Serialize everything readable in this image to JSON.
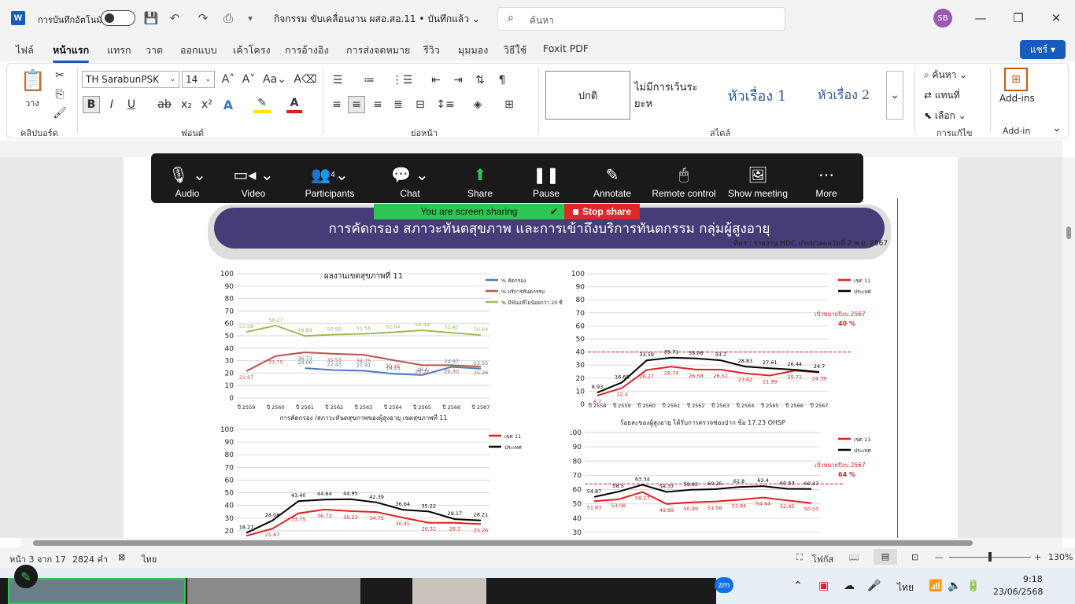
{
  "titlebar": {
    "autosave_label": "การบันทึกอัตโนมัติ",
    "doc_title": "กิจกรรม ขับเคลื่อนงาน ผสอ.สอ.11 • บันทึกแล้ว ⌄",
    "search_placeholder": "ค้นหา",
    "avatar": "SB"
  },
  "menu": {
    "tabs": [
      "ไฟล์",
      "หน้าแรก",
      "แทรก",
      "วาด",
      "ออกแบบ",
      "เค้าโครง",
      "การอ้างอิง",
      "การส่งจดหมาย",
      "รีวิว",
      "มุมมอง",
      "วิธีใช้",
      "Foxit PDF"
    ],
    "share": "แชร์"
  },
  "ribbon": {
    "paste": "วาง",
    "font_name": "TH SarabunPSK",
    "font_size": "14",
    "group_clipboard": "คลิปบอร์ด",
    "group_font": "ฟอนต์",
    "group_paragraph": "ย่อหน้า",
    "group_styles": "สไตล์",
    "group_editing": "การแก้ไข",
    "group_addin": "Add-in",
    "styles": [
      "ปกติ",
      "ไม่มีการเว้นระยะห",
      "หัวเรื่อง 1",
      "หัวเรื่อง 2"
    ],
    "find": "ค้นหา",
    "replace": "แทนที่",
    "select": "เลือก",
    "addins": "Add-ins",
    "bold": "B",
    "italic": "I",
    "underline": "U",
    "strike": "ab",
    "sub": "x₂",
    "sup": "x²"
  },
  "zoom": {
    "buttons": [
      {
        "label": "Audio"
      },
      {
        "label": "Video"
      },
      {
        "label": "Participants",
        "badge": "4"
      },
      {
        "label": "Chat"
      },
      {
        "label": "Share"
      },
      {
        "label": "Pause"
      },
      {
        "label": "Annotate"
      },
      {
        "label": "Remote control"
      },
      {
        "label": "Show meeting"
      },
      {
        "label": "More"
      }
    ],
    "sharing_text": "You are screen sharing",
    "stop_text": "Stop share"
  },
  "slide": {
    "title": "การคัดกรอง สภาวะทันตสุขภาพ และการเข้าถึงบริการทันตกรรม กลุ่มผู้สูงอายุ",
    "source": "ที่มา : รายงาน HDC ประมวลผลวันที่ 2 พ.ย. 2567",
    "vline": true
  },
  "chart_data": [
    {
      "type": "line",
      "title": "ผลงานเขตสุขภาพที่ 11",
      "categories": [
        "ปี 2559",
        "ปี 2560",
        "ปี 2561",
        "ปี 2562",
        "ปี 2563",
        "ปี 2564",
        "ปี 2565",
        "ปี 2566",
        "ปี 2567"
      ],
      "ylim": [
        0,
        100
      ],
      "legend": "top-right",
      "series": [
        {
          "name": "% คัดกรอง",
          "color": "#4a7ab7",
          "values": [
            null,
            null,
            24.0,
            22.43,
            21.91,
            19.45,
            18.4,
            24.97,
            23.55
          ]
        },
        {
          "name": "% บริการทันตกรรม",
          "color": "#c0504d",
          "values": [
            21.67,
            33.75,
            36.73,
            35.53,
            34.75,
            30.45,
            26.32,
            26.3,
            25.26
          ]
        },
        {
          "name": "% มีฟันแท้ไม่น้อยกว่า 20 ซี่",
          "color": "#9bbb59",
          "values": [
            53.08,
            58.27,
            49.89,
            50.99,
            51.56,
            52.84,
            54.44,
            52.45,
            50.64
          ]
        }
      ],
      "point_labels": [
        [
          "",
          "",
          "24.00",
          "22.43",
          "21.91",
          "19.45",
          "18.4",
          "24.97",
          "23.55"
        ],
        [
          "21.67",
          "33.75",
          "36.73",
          "35.53",
          "34.75",
          "30.45",
          "26.32",
          "26.30",
          "25.26"
        ],
        [
          "53.08",
          "58.27",
          "49.89",
          "50.99",
          "51.56",
          "52.84",
          "54.44",
          "52.45",
          "50.64"
        ]
      ]
    },
    {
      "type": "line",
      "title": "",
      "categories": [
        "ปี 2558",
        "ปี 2559",
        "ปี 2560",
        "ปี 2561",
        "ปี 2562",
        "ปี 2563",
        "ปี 2564",
        "ปี 2565",
        "ปี 2566",
        "ปี 2567"
      ],
      "ylim": [
        0,
        100
      ],
      "legend": "top-right",
      "target": {
        "label": "เป้าหมายปีงบ 2567",
        "value_label": "40 %",
        "value": 40
      },
      "series": [
        {
          "name": "เขต 11",
          "color": "#e02020",
          "values": [
            6.7,
            12.4,
            26.27,
            28.74,
            26.58,
            26.51,
            23.62,
            21.99,
            25.71,
            24.39
          ]
        },
        {
          "name": "ประเทศ",
          "color": "#000000",
          "values": [
            8.93,
            16.68,
            33.59,
            35.71,
            35.06,
            33.7,
            28.83,
            27.61,
            26.44,
            24.7
          ]
        }
      ],
      "point_labels": [
        [
          "6.7",
          "12.4",
          "26.27",
          "28.74",
          "26.58",
          "26.51",
          "23.62",
          "21.99",
          "25.71",
          "24.39"
        ],
        [
          "8.93",
          "16.68",
          "33.59",
          "35.71",
          "35.06",
          "33.7",
          "28.83",
          "27.61",
          "26.44",
          "24.7"
        ]
      ]
    },
    {
      "type": "line",
      "title": "การคัดกรอง /สภาวะทันตสุขภาพของผู้สูงอายุ เขตสุขภาพที่ 11",
      "ylim": [
        10,
        100
      ],
      "visible_ticks": [
        20,
        30,
        40,
        50,
        60,
        70,
        80,
        90,
        100
      ],
      "legend": "top-right",
      "series": [
        {
          "name": "เขต 11",
          "color": "#e02020",
          "values": [
            16.0,
            21.67,
            33.75,
            36.73,
            35.53,
            34.75,
            30.45,
            26.32,
            26.3,
            25.26
          ]
        },
        {
          "name": "ประเทศ",
          "color": "#000000",
          "values": [
            18.27,
            28.08,
            43.4,
            44.64,
            44.95,
            42.39,
            36.64,
            35.22,
            29.17,
            28.21
          ]
        }
      ],
      "point_labels": [
        [
          "",
          "21.67",
          "33.75",
          "36.73",
          "35.53",
          "34.75",
          "30.45",
          "26.32",
          "26.3",
          "25.26"
        ],
        [
          "18.27",
          "28.08",
          "43.40",
          "44.64",
          "44.95",
          "42.39",
          "36.64",
          "35.22",
          "29.17",
          "28.21"
        ]
      ]
    },
    {
      "type": "line",
      "title": "ร้อยละของผู้สูงอายุ ได้รับการตรวจช่องปาก ข้อ 17.23 OHSP",
      "ylim": [
        20,
        100
      ],
      "visible_ticks": [
        20,
        30,
        40,
        50,
        60,
        70,
        80,
        90,
        100
      ],
      "legend": "top-right",
      "target": {
        "label": "เป้าหมายปีงบ 2567",
        "value_label": "64 %",
        "value": 64
      },
      "series": [
        {
          "name": "เขต 11",
          "color": "#e02020",
          "values": [
            51.83,
            53.08,
            58.27,
            49.89,
            50.99,
            51.56,
            52.84,
            54.44,
            52.45,
            50.53
          ]
        },
        {
          "name": "ประเทศ",
          "color": "#000000",
          "values": [
            54.87,
            58.5,
            63.34,
            58.37,
            59.83,
            60.25,
            61.8,
            62.4,
            60.53,
            60.37
          ]
        }
      ],
      "point_labels": [
        [
          "51.83",
          "53.08",
          "58.27",
          "49.89",
          "50.99",
          "51.56",
          "52.84",
          "54.44",
          "52.45",
          "50.53"
        ],
        [
          "54.87",
          "58.5",
          "63.34",
          "58.37",
          "59.83",
          "60.25",
          "61.8",
          "62.4",
          "60.53",
          "60.37"
        ]
      ]
    }
  ],
  "status": {
    "page": "หน้า 3 จาก 17",
    "words": "2824 คำ",
    "lang": "ไทย",
    "focus": "โฟกัส",
    "zoom": "130%"
  },
  "taskbar": {
    "lang": "ไทย",
    "time": "9:18",
    "date": "23/06/2568",
    "zoom_app": "zm"
  }
}
